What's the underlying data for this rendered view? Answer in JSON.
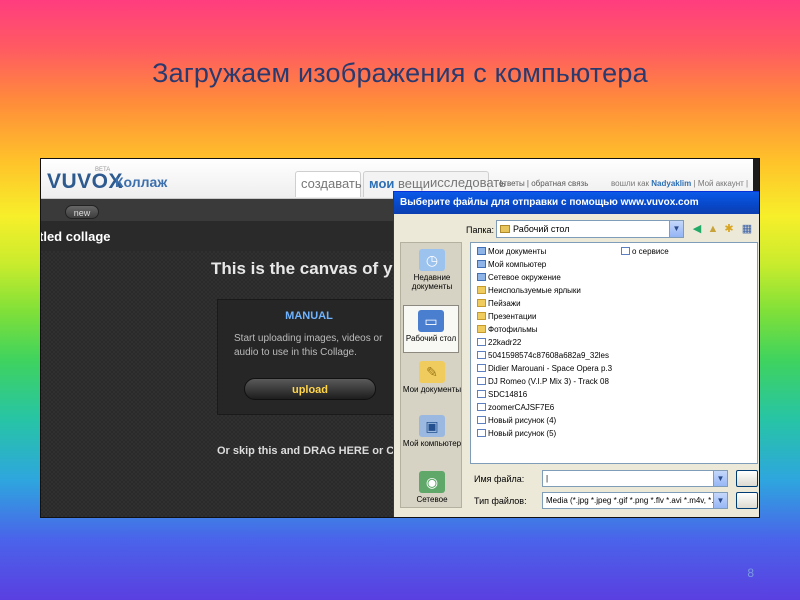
{
  "slide": {
    "title": "Загружаем изображения с компьютера",
    "page_number": "8"
  },
  "vuvox": {
    "logo": "VUVOX",
    "beta": "BETA",
    "app_name": "Коллаж",
    "tabs": {
      "create": "создавать",
      "my": "мои",
      "my_things": "вещи",
      "explore": "исследовать"
    },
    "links": "ответы | обратная связь",
    "logged_in_prefix": "вошли как",
    "username": "Nadyaklim",
    "account": "| Мой аккаунт |",
    "new_button": "new",
    "collage_title": "tled collage",
    "canvas_heading": "This is the canvas of y",
    "manual_title": "MANUAL",
    "manual_text": "Start uploading images, videos or audio to use in this Collage.",
    "upload_button": "upload",
    "drag_text": "Or skip this and DRAG HERE or CLIC"
  },
  "dialog": {
    "title": "Выберите файлы для отправки с помощью www.vuvox.com",
    "folder_label": "Папка:",
    "folder_value": "Рабочий стол",
    "places": [
      {
        "label": "Недавние документы",
        "icon": "recent-docs-icon"
      },
      {
        "label": "Рабочий стол",
        "icon": "desktop-icon"
      },
      {
        "label": "Мои документы",
        "icon": "my-documents-icon"
      },
      {
        "label": "Мой компьютер",
        "icon": "my-computer-icon"
      },
      {
        "label": "Сетевое",
        "icon": "network-icon"
      }
    ],
    "files_col1": [
      {
        "name": "Мои документы",
        "type": "sys"
      },
      {
        "name": "Мой компьютер",
        "type": "sys"
      },
      {
        "name": "Сетевое окружение",
        "type": "sys"
      },
      {
        "name": "Неиспользуемые ярлыки",
        "type": "folder"
      },
      {
        "name": "Пейзажи",
        "type": "folder"
      },
      {
        "name": "Презентации",
        "type": "folder"
      },
      {
        "name": "Фотофильмы",
        "type": "folder"
      },
      {
        "name": "22kadr22",
        "type": "file"
      },
      {
        "name": "5041598574c87608a682a9_32les",
        "type": "file"
      },
      {
        "name": "Didier Marouani - Space Opera p.3",
        "type": "file"
      },
      {
        "name": "DJ Romeo (V.I.P Mix 3) - Track 08",
        "type": "file"
      },
      {
        "name": "SDC14816",
        "type": "file"
      },
      {
        "name": "zoomerCAJSF7E6",
        "type": "file"
      },
      {
        "name": "Новый рисунок (4)",
        "type": "file"
      },
      {
        "name": "Новый рисунок (5)",
        "type": "file"
      }
    ],
    "files_col2": [
      {
        "name": "о сервисе",
        "type": "file"
      }
    ],
    "filename_label": "Имя файла:",
    "filename_value": "|",
    "filetype_label": "Тип файлов:",
    "filetype_value": "Media (*.jpg *.jpeg *.gif *.png *.flv *.avi *.m4v, *.»"
  }
}
